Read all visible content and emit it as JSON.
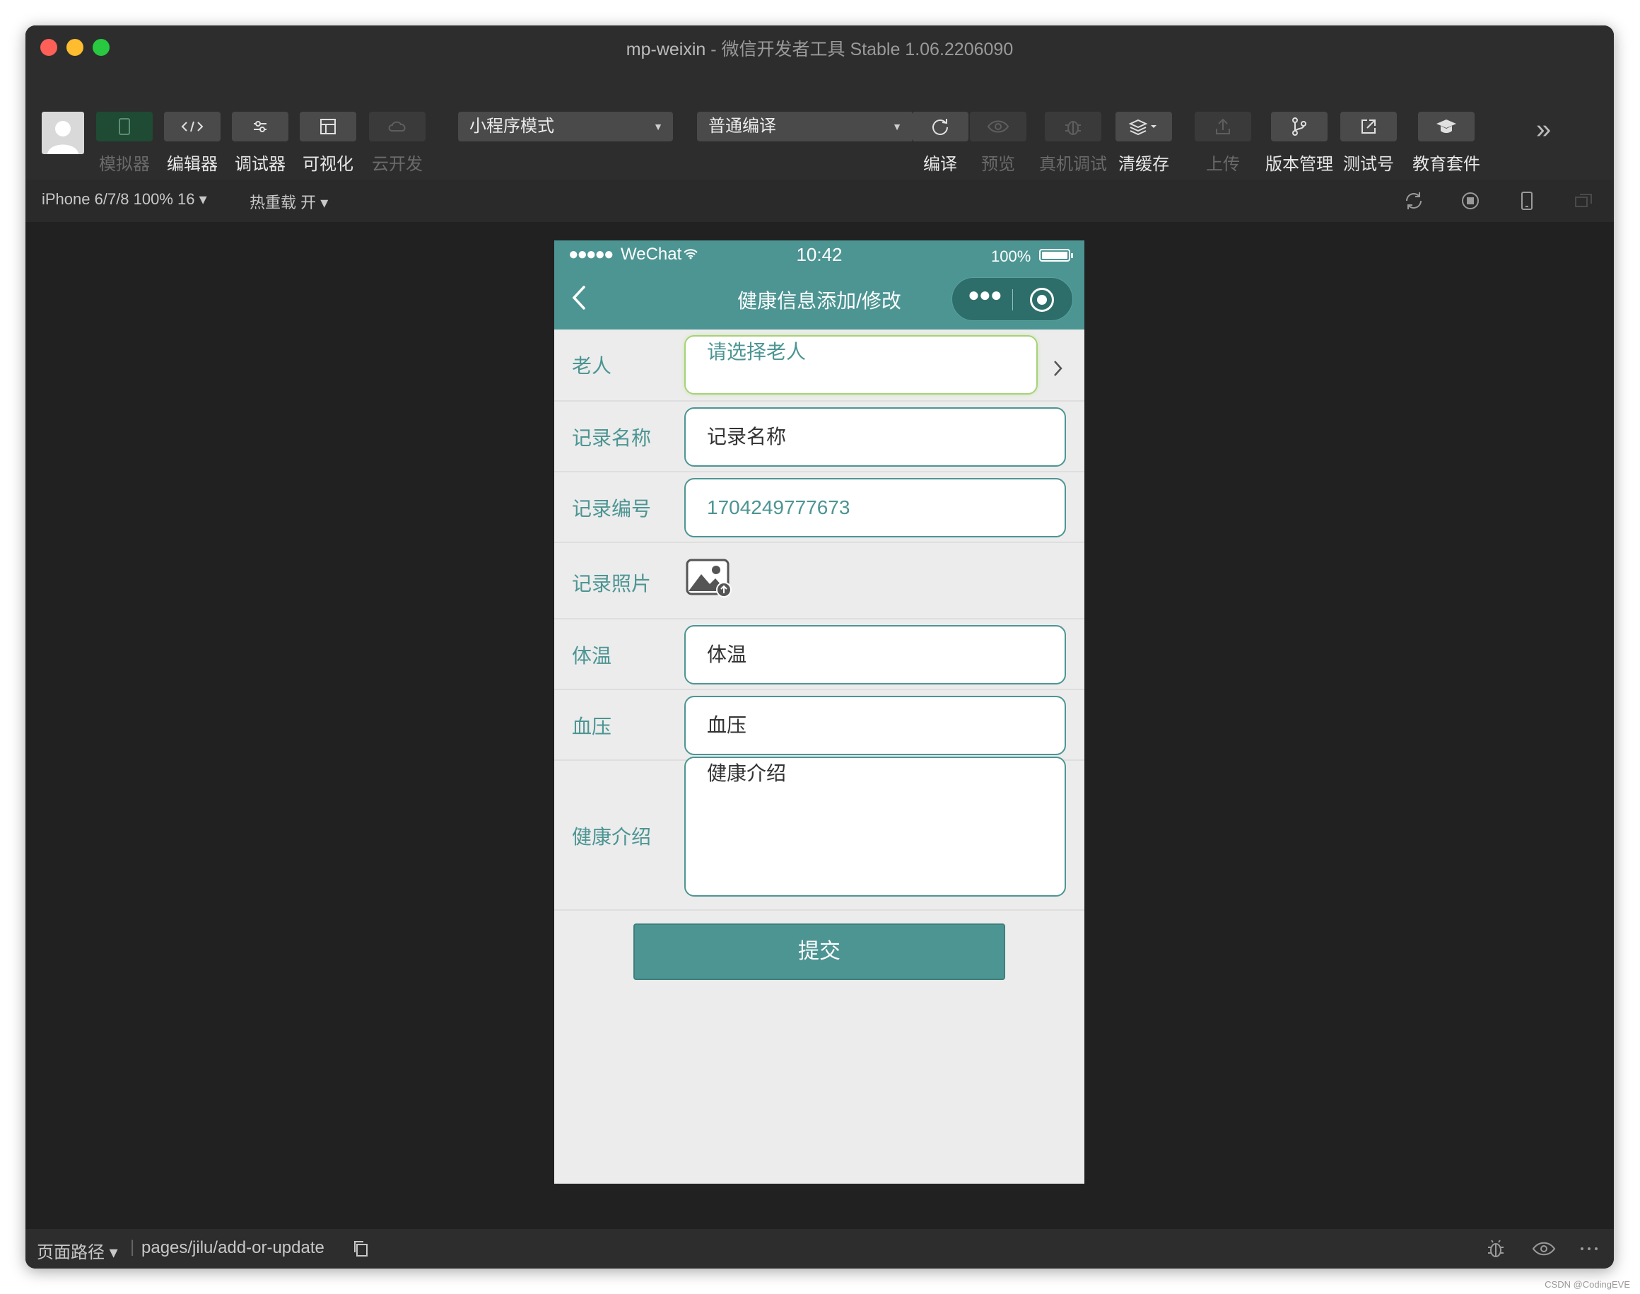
{
  "window": {
    "title_app": "mp-weixin",
    "title_sep": " - ",
    "title_rest": "微信开发者工具 Stable 1.06.2206090"
  },
  "toolbar": {
    "simulator": "模拟器",
    "editor": "编辑器",
    "debugger": "调试器",
    "visual": "可视化",
    "cloud": "云开发",
    "mode_select": "小程序模式",
    "compile_select": "普通编译",
    "compile": "编译",
    "preview": "预览",
    "real_debug": "真机调试",
    "clear_cache": "清缓存",
    "upload": "上传",
    "version": "版本管理",
    "test_account": "测试号",
    "edu": "教育套件",
    "more": "»"
  },
  "subbar": {
    "device": "iPhone 6/7/8 100% 16 ▾",
    "hot_reload": "热重载 开 ▾"
  },
  "phone": {
    "status": {
      "signal": "●●●●●",
      "carrier": "WeChat",
      "time": "10:42",
      "battery": "100%"
    },
    "nav": {
      "title": "健康信息添加/修改",
      "dots": "●●●"
    },
    "form": {
      "elder_label": "老人",
      "elder_placeholder": "请选择老人",
      "record_name_label": "记录名称",
      "record_name_placeholder": "记录名称",
      "record_no_label": "记录编号",
      "record_no_value": "1704249777673",
      "photo_label": "记录照片",
      "temp_label": "体温",
      "temp_placeholder": "体温",
      "bp_label": "血压",
      "bp_placeholder": "血压",
      "intro_label": "健康介绍",
      "intro_placeholder": "健康介绍",
      "submit": "提交"
    }
  },
  "statusbar": {
    "path_label": "页面路径 ▾",
    "separator": "|",
    "path": "pages/jilu/add-or-update"
  },
  "watermark": "CSDN @CodingEVE"
}
